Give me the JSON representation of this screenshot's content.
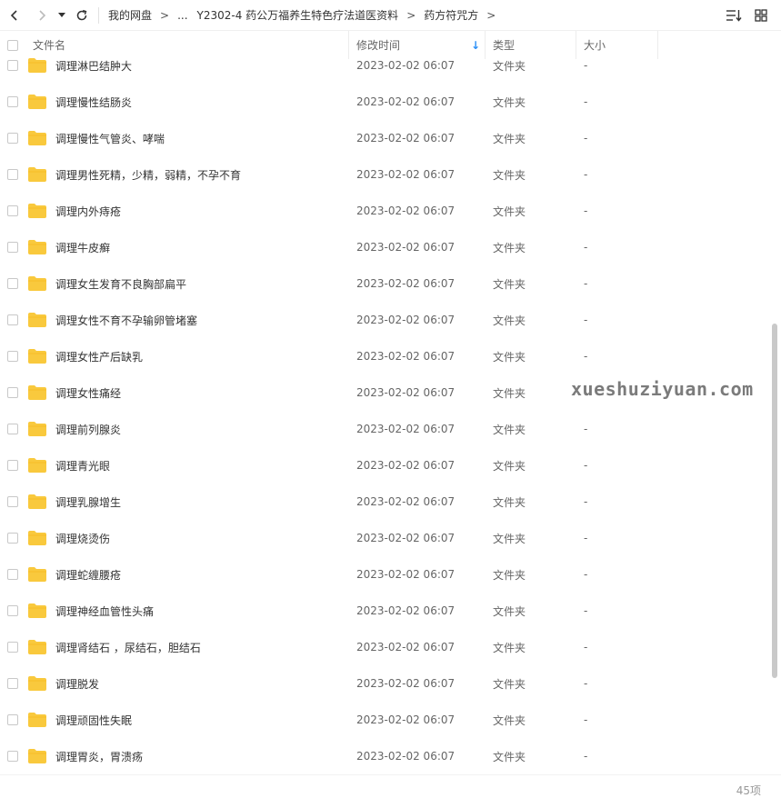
{
  "breadcrumb": {
    "items": [
      "我的网盘",
      "...",
      "Y2302-4 药公万福养生特色疗法道医资料",
      "药方符咒方"
    ]
  },
  "header": {
    "name": "文件名",
    "time": "修改时间",
    "type": "类型",
    "size": "大小",
    "sort_indicator": "↓"
  },
  "files": [
    {
      "name": "调理淋巴结肿大",
      "time": "2023-02-02 06:07",
      "type": "文件夹",
      "size": "-"
    },
    {
      "name": "调理慢性结肠炎",
      "time": "2023-02-02 06:07",
      "type": "文件夹",
      "size": "-"
    },
    {
      "name": "调理慢性气管炎、哮喘",
      "time": "2023-02-02 06:07",
      "type": "文件夹",
      "size": "-"
    },
    {
      "name": "调理男性死精，少精，弱精，不孕不育",
      "time": "2023-02-02 06:07",
      "type": "文件夹",
      "size": "-"
    },
    {
      "name": "调理内外痔疮",
      "time": "2023-02-02 06:07",
      "type": "文件夹",
      "size": "-"
    },
    {
      "name": "调理牛皮癣",
      "time": "2023-02-02 06:07",
      "type": "文件夹",
      "size": "-"
    },
    {
      "name": "调理女生发育不良胸部扁平",
      "time": "2023-02-02 06:07",
      "type": "文件夹",
      "size": "-"
    },
    {
      "name": "调理女性不育不孕输卵管堵塞",
      "time": "2023-02-02 06:07",
      "type": "文件夹",
      "size": "-"
    },
    {
      "name": "调理女性产后缺乳",
      "time": "2023-02-02 06:07",
      "type": "文件夹",
      "size": "-"
    },
    {
      "name": "调理女性痛经",
      "time": "2023-02-02 06:07",
      "type": "文件夹",
      "size": "-"
    },
    {
      "name": "调理前列腺炎",
      "time": "2023-02-02 06:07",
      "type": "文件夹",
      "size": "-"
    },
    {
      "name": "调理青光眼",
      "time": "2023-02-02 06:07",
      "type": "文件夹",
      "size": "-"
    },
    {
      "name": "调理乳腺增生",
      "time": "2023-02-02 06:07",
      "type": "文件夹",
      "size": "-"
    },
    {
      "name": "调理烧烫伤",
      "time": "2023-02-02 06:07",
      "type": "文件夹",
      "size": "-"
    },
    {
      "name": "调理蛇缠腰疮",
      "time": "2023-02-02 06:07",
      "type": "文件夹",
      "size": "-"
    },
    {
      "name": "调理神经血管性头痛",
      "time": "2023-02-02 06:07",
      "type": "文件夹",
      "size": "-"
    },
    {
      "name": "调理肾结石 ，尿结石，胆结石",
      "time": "2023-02-02 06:07",
      "type": "文件夹",
      "size": "-"
    },
    {
      "name": "调理脱发",
      "time": "2023-02-02 06:07",
      "type": "文件夹",
      "size": "-"
    },
    {
      "name": "调理顽固性失眠",
      "time": "2023-02-02 06:07",
      "type": "文件夹",
      "size": "-"
    },
    {
      "name": "调理胃炎，胃溃疡",
      "time": "2023-02-02 06:07",
      "type": "文件夹",
      "size": "-"
    }
  ],
  "watermark": "xueshuziyuan.com",
  "footer": {
    "count": "45项"
  },
  "colors": {
    "folder": "#f9c93d",
    "sort_arrow": "#2a8ff7",
    "scroll_thumb": "#c9c9c9"
  }
}
